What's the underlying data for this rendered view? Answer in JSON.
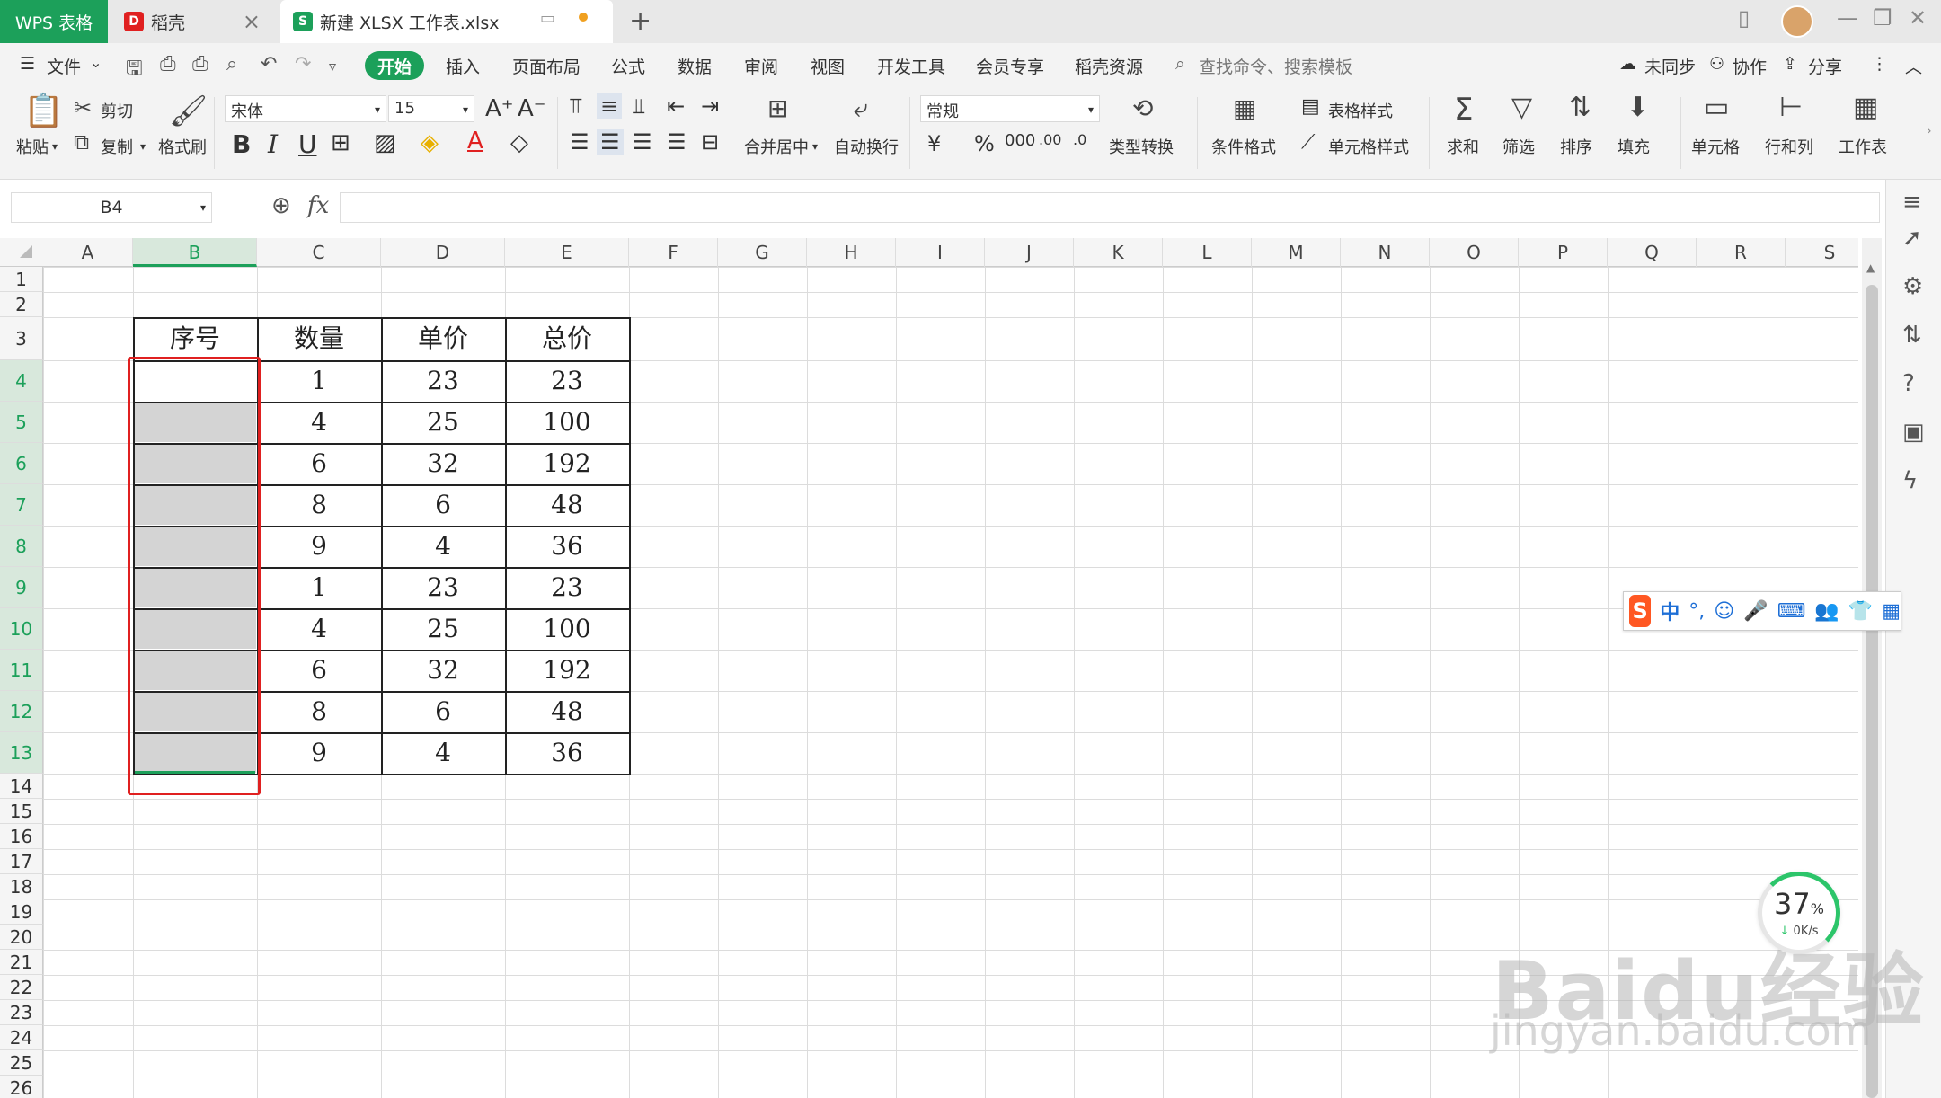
{
  "titlebar": {
    "app_tab": "WPS 表格",
    "tab2": "稻壳",
    "file_tab": "新建 XLSX 工作表.xlsx",
    "add": "+"
  },
  "menubar": {
    "file": "文件",
    "items": [
      "开始",
      "插入",
      "页面布局",
      "公式",
      "数据",
      "审阅",
      "视图",
      "开发工具",
      "会员专享",
      "稻壳资源"
    ],
    "search_placeholder": "查找命令、搜索模板",
    "unsynced": "未同步",
    "collab": "协作",
    "share": "分享"
  },
  "ribbon": {
    "paste": "粘贴",
    "cut": "剪切",
    "copy": "复制",
    "format_painter": "格式刷",
    "font_name": "宋体",
    "font_size": "15",
    "bold": "B",
    "italic": "I",
    "underline": "U",
    "merge_center": "合并居中",
    "wrap_text": "自动换行",
    "number_format": "常规",
    "type_convert": "类型转换",
    "cond_format": "条件格式",
    "table_style": "表格样式",
    "cell_style": "单元格样式",
    "sum": "求和",
    "filter": "筛选",
    "sort": "排序",
    "fill": "填充",
    "cell": "单元格",
    "row_col": "行和列",
    "worksheet": "工作表"
  },
  "formula": {
    "namebox": "B4",
    "fx": "fx"
  },
  "columns": [
    "A",
    "B",
    "C",
    "D",
    "E",
    "F",
    "G",
    "H",
    "I",
    "J",
    "K",
    "L",
    "M",
    "N",
    "O",
    "P",
    "Q",
    "R",
    "S"
  ],
  "rows": [
    "1",
    "2",
    "3",
    "4",
    "5",
    "6",
    "7",
    "8",
    "9",
    "10",
    "11",
    "12",
    "13",
    "14",
    "15",
    "16",
    "17",
    "18",
    "19",
    "20",
    "21",
    "22",
    "23",
    "24",
    "25",
    "26"
  ],
  "table": {
    "headers": [
      "序号",
      "数量",
      "单价",
      "总价"
    ],
    "rows": [
      [
        "",
        "1",
        "23",
        "23"
      ],
      [
        "",
        "4",
        "25",
        "100"
      ],
      [
        "",
        "6",
        "32",
        "192"
      ],
      [
        "",
        "8",
        "6",
        "48"
      ],
      [
        "",
        "9",
        "4",
        "36"
      ],
      [
        "",
        "1",
        "23",
        "23"
      ],
      [
        "",
        "4",
        "25",
        "100"
      ],
      [
        "",
        "6",
        "32",
        "192"
      ],
      [
        "",
        "8",
        "6",
        "48"
      ],
      [
        "",
        "9",
        "4",
        "36"
      ]
    ]
  },
  "ime": {
    "logo": "S",
    "mode": "中"
  },
  "speed": {
    "percent": "37",
    "unit": "%",
    "rate": "0K/s"
  },
  "watermark": {
    "brand": "Baidu经验",
    "url": "jingyan.baidu.com"
  },
  "colors": {
    "accent": "#1ca05a",
    "highlight_box": "#e02020",
    "selected_fill": "#d4d4d4"
  }
}
